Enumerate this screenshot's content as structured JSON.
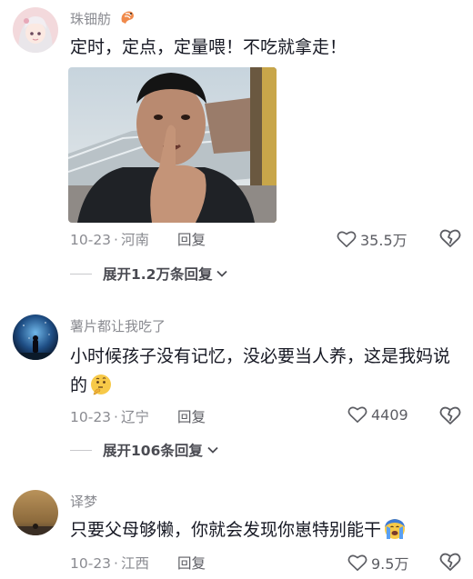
{
  "comments": [
    {
      "username": "珠钿舫",
      "text": "定时，定点，定量喂！不吃就拿走！",
      "date": "10-23",
      "location": "河南",
      "reply_label": "回复",
      "likes": "35.5万",
      "replies_label": "展开1.2万条回复"
    },
    {
      "username": "薯片都让我吃了",
      "text": "小时候孩子没有记忆，没必要当人养，这是我妈说的",
      "date": "10-23",
      "location": "辽宁",
      "reply_label": "回复",
      "likes": "4409",
      "replies_label": "展开106条回复"
    },
    {
      "username": "译梦",
      "text": "只要父母够懒，你就会发现你崽特别能干",
      "date": "10-23",
      "location": "江西",
      "reply_label": "回复",
      "likes": "9.5万"
    }
  ],
  "icons": {
    "like": "heart-outline-icon",
    "dislike": "broken-heart-icon",
    "expand": "chevron-down-icon",
    "badge": "shrimp-icon",
    "emoji_thinking": "thinking-face-emoji",
    "emoji_crying": "crying-face-emoji"
  },
  "colors": {
    "text": "#161823",
    "muted": "#8a8b91",
    "meta": "#5c5d63"
  }
}
